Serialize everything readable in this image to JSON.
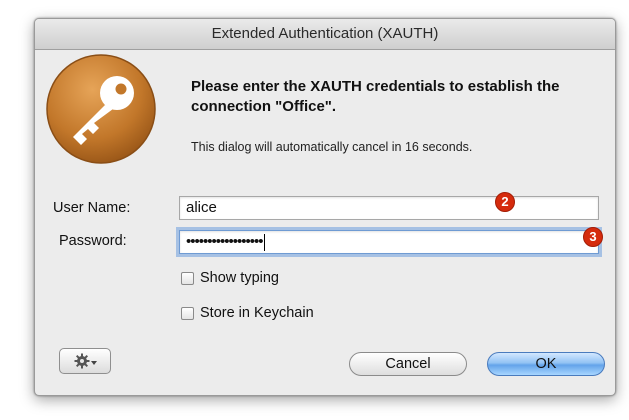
{
  "dialog": {
    "title": "Extended Authentication (XAUTH)",
    "headline": "Please enter the XAUTH credentials to establish the connection \"Office\".",
    "note": "This dialog will automatically cancel in 16 seconds."
  },
  "form": {
    "username_label": "User Name:",
    "username_value": "alice",
    "password_label": "Password:",
    "password_masked": "••••••••••••••••••",
    "show_typing_label": "Show typing",
    "show_typing_checked": false,
    "store_keychain_label": "Store in Keychain",
    "store_keychain_checked": false
  },
  "annotations": {
    "badge_2": "2",
    "badge_3": "3"
  },
  "buttons": {
    "cancel_label": "Cancel",
    "ok_label": "OK",
    "gear_icon": "gear-icon"
  },
  "colors": {
    "key_icon_bg": "#c2772a",
    "badge": "#d52b0d",
    "ok_button": "#63a3ea",
    "focus_ring": "#6f9bd3"
  }
}
